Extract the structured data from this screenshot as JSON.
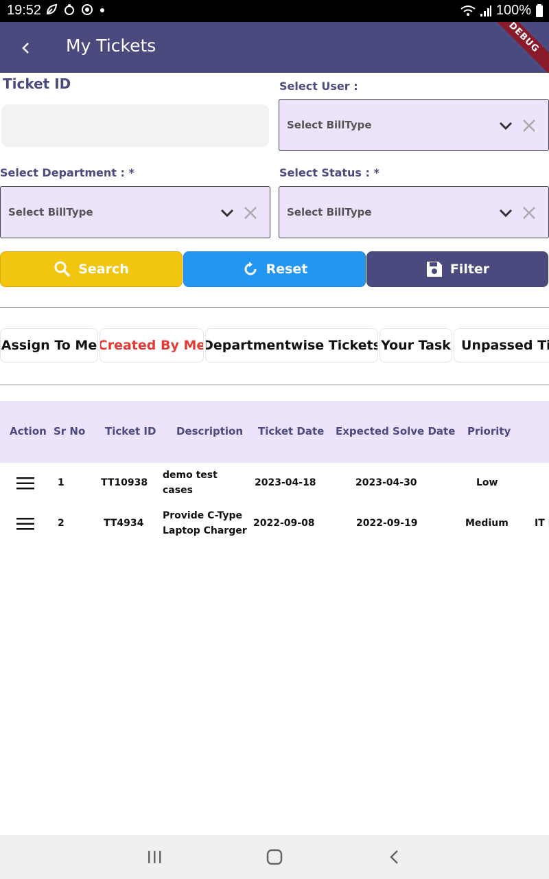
{
  "status_bar": {
    "time": "19:52",
    "battery": "100%"
  },
  "app_bar": {
    "title": "My Tickets",
    "debug_banner": "DEBUG"
  },
  "form": {
    "ticket_id_label": "Ticket ID",
    "ticket_id_value": "",
    "select_user_label": "Select User :",
    "select_user_value": "Select BillType",
    "select_department_label": "Select Department : *",
    "select_department_value": "Select BillType",
    "select_status_label": "Select Status : *",
    "select_status_value": "Select BillType"
  },
  "buttons": {
    "search": "Search",
    "reset": "Reset",
    "filter": "Filter"
  },
  "colors": {
    "primary": "#4a4a7e",
    "search_btn": "#f2c511",
    "reset_btn": "#2196f3",
    "filter_btn": "#4a4a7e",
    "active_tab": "#e53935",
    "select_bg": "#ede3fb"
  },
  "tabs": [
    {
      "label": "Assign To Me",
      "active": false
    },
    {
      "label": "Created By Me",
      "active": true
    },
    {
      "label": "Departmentwise Tickets",
      "active": false
    },
    {
      "label": "Your Task",
      "active": false
    },
    {
      "label": "Unpassed Tick",
      "active": false
    }
  ],
  "table": {
    "columns": [
      "Action",
      "Sr No",
      "Ticket ID",
      "Description",
      "Ticket Date",
      "Expected Solve Date",
      "Priority"
    ],
    "rows": [
      {
        "sr_no": "1",
        "ticket_id": "TT10938",
        "description_line1": "demo test",
        "description_line2": "cases",
        "ticket_date": "2023-04-18",
        "expected_solve_date": "2023-04-30",
        "priority": "Low",
        "extra": ""
      },
      {
        "sr_no": "2",
        "ticket_id": "TT4934",
        "description_line1": "Provide C-Type",
        "description_line2": "Laptop Charger",
        "ticket_date": "2022-09-08",
        "expected_solve_date": "2022-09-19",
        "priority": "Medium",
        "extra": "IT I"
      }
    ]
  },
  "icons": {
    "back": "arrow-left-icon",
    "dropdown": "chevron-down-icon",
    "clear": "close-icon",
    "search": "search-icon",
    "reset": "refresh-icon",
    "filter": "save-icon",
    "row_action": "menu-icon"
  }
}
